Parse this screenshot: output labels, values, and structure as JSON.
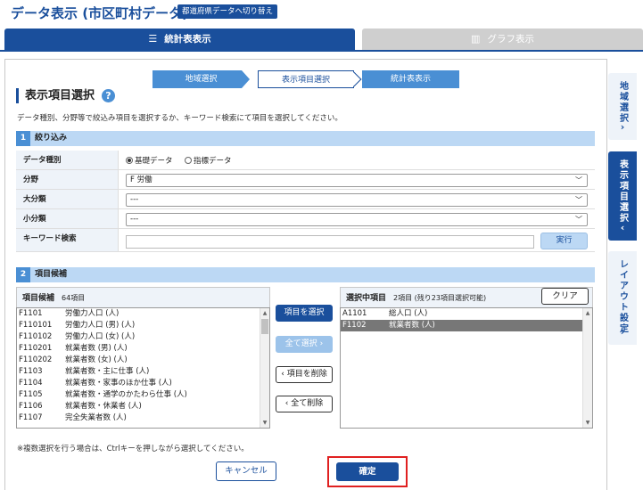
{
  "header": {
    "title": "データ表示 (市区町村データ)",
    "switch_label": "都道府県データへ切り替え"
  },
  "tabs": [
    {
      "label": "統計表表示",
      "icon": "list-icon",
      "active": true
    },
    {
      "label": "グラフ表示",
      "icon": "bar-chart-icon",
      "active": false
    }
  ],
  "steps": [
    "地域選択",
    "表示項目選択",
    "統計表表示"
  ],
  "section": {
    "title": "表示項目選択",
    "help": "?",
    "description": "データ種別、分野等で絞込み項目を選択するか、キーワード検索にて項目を選択してください。"
  },
  "filter": {
    "number": "1",
    "title": "絞り込み",
    "data_type_label": "データ種別",
    "data_type_options": [
      "基礎データ",
      "指標データ"
    ],
    "data_type_selected": "基礎データ",
    "field_label": "分野",
    "field_value": "F 労働",
    "major_label": "大分類",
    "major_value": "---",
    "minor_label": "小分類",
    "minor_value": "---",
    "keyword_label": "キーワード検索",
    "keyword_value": "",
    "exec_label": "実行"
  },
  "candidates": {
    "number": "2",
    "title": "項目候補",
    "list_title": "項目候補",
    "count": "64項目",
    "items": [
      {
        "code": "F1101",
        "name": "労働力人口 (人)"
      },
      {
        "code": "F110101",
        "name": "労働力人口 (男) (人)"
      },
      {
        "code": "F110102",
        "name": "労働力人口 (女) (人)"
      },
      {
        "code": "F110201",
        "name": "就業者数 (男) (人)"
      },
      {
        "code": "F110202",
        "name": "就業者数 (女) (人)"
      },
      {
        "code": "F1103",
        "name": "就業者数・主に仕事 (人)"
      },
      {
        "code": "F1104",
        "name": "就業者数・家事のほか仕事 (人)"
      },
      {
        "code": "F1105",
        "name": "就業者数・通学のかたわら仕事 (人)"
      },
      {
        "code": "F1106",
        "name": "就業者数・休業者 (人)"
      },
      {
        "code": "F1107",
        "name": "完全失業者数 (人)"
      }
    ]
  },
  "actions": {
    "add": "項目を選択",
    "add_all": "全て選択",
    "remove": "項目を削除",
    "remove_all": "全て削除"
  },
  "selected": {
    "title": "選択中項目",
    "count": "2項目 (残り23項目選択可能)",
    "clear_label": "クリア",
    "items": [
      {
        "code": "A1101",
        "name": "総人口 (人)",
        "highlighted": false
      },
      {
        "code": "F1102",
        "name": "就業者数 (人)",
        "highlighted": true
      }
    ]
  },
  "note": "※複数選択を行う場合は、Ctrlキーを押しながら選択してください。",
  "buttons": {
    "cancel": "キャンセル",
    "confirm": "確定"
  },
  "side_tabs": [
    {
      "label": "地域選択",
      "active": false
    },
    {
      "label": "表示項目選択",
      "active": true
    },
    {
      "label": "レイアウト設定",
      "active": false
    }
  ],
  "colors": {
    "primary": "#1a4f9c",
    "accent": "#4a8fd4",
    "section_bar": "#bcd8f4",
    "highlight_border": "#e02020"
  }
}
